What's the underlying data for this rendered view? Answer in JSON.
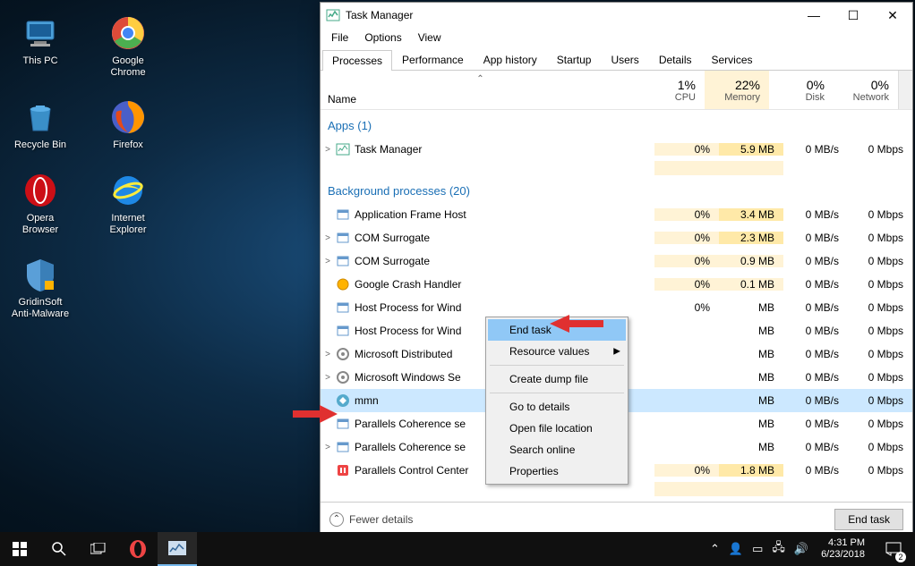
{
  "desktop": {
    "icons": [
      [
        {
          "name": "this-pc",
          "label": "This PC"
        },
        {
          "name": "chrome",
          "label": "Google Chrome"
        }
      ],
      [
        {
          "name": "recycle-bin",
          "label": "Recycle Bin"
        },
        {
          "name": "firefox",
          "label": "Firefox"
        }
      ],
      [
        {
          "name": "opera",
          "label": "Opera Browser"
        },
        {
          "name": "ie",
          "label": "Internet Explorer"
        }
      ],
      [
        {
          "name": "gridinsoft",
          "label": "GridinSoft Anti-Malware"
        }
      ]
    ]
  },
  "window": {
    "title": "Task Manager",
    "menu": [
      "File",
      "Options",
      "View"
    ],
    "tabs": [
      "Processes",
      "Performance",
      "App history",
      "Startup",
      "Users",
      "Details",
      "Services"
    ],
    "active_tab": 0,
    "columns": {
      "name": "Name",
      "cols": [
        {
          "pct": "1%",
          "lbl": "CPU",
          "hi": false
        },
        {
          "pct": "22%",
          "lbl": "Memory",
          "hi": true
        },
        {
          "pct": "0%",
          "lbl": "Disk",
          "hi": false
        },
        {
          "pct": "0%",
          "lbl": "Network",
          "hi": false
        }
      ]
    },
    "groups": [
      {
        "title": "Apps (1)",
        "rows": [
          {
            "expand": ">",
            "icon": "tm",
            "name": "Task Manager",
            "cpu": "0%",
            "mem": "5.9 MB",
            "disk": "0 MB/s",
            "net": "0 Mbps",
            "memhi": true
          }
        ]
      },
      {
        "title": "Background processes (20)",
        "rows": [
          {
            "expand": "",
            "icon": "app",
            "name": "Application Frame Host",
            "cpu": "0%",
            "mem": "3.4 MB",
            "disk": "0 MB/s",
            "net": "0 Mbps",
            "memhi": true
          },
          {
            "expand": ">",
            "icon": "app",
            "name": "COM Surrogate",
            "cpu": "0%",
            "mem": "2.3 MB",
            "disk": "0 MB/s",
            "net": "0 Mbps",
            "memhi": true
          },
          {
            "expand": ">",
            "icon": "app",
            "name": "COM Surrogate",
            "cpu": "0%",
            "mem": "0.9 MB",
            "disk": "0 MB/s",
            "net": "0 Mbps"
          },
          {
            "expand": "",
            "icon": "gch",
            "name": "Google Crash Handler",
            "cpu": "0%",
            "mem": "0.1 MB",
            "disk": "0 MB/s",
            "net": "0 Mbps"
          },
          {
            "expand": "",
            "icon": "app",
            "name": "Host Process for Wind",
            "cpu": "0%",
            "mem": "MB",
            "disk": "0 MB/s",
            "net": "0 Mbps",
            "cut": true
          },
          {
            "expand": "",
            "icon": "app",
            "name": "Host Process for Wind",
            "cpu": "",
            "mem": "MB",
            "disk": "0 MB/s",
            "net": "0 Mbps",
            "cut": true
          },
          {
            "expand": ">",
            "icon": "svc",
            "name": "Microsoft Distributed",
            "cpu": "",
            "mem": "MB",
            "disk": "0 MB/s",
            "net": "0 Mbps",
            "cut": true
          },
          {
            "expand": ">",
            "icon": "svc",
            "name": "Microsoft Windows Se",
            "cpu": "",
            "mem": "MB",
            "disk": "0 MB/s",
            "net": "0 Mbps",
            "cut": true
          },
          {
            "expand": "",
            "icon": "mmn",
            "name": "mmn",
            "cpu": "",
            "mem": "MB",
            "disk": "0 MB/s",
            "net": "0 Mbps",
            "selected": true,
            "cut": true
          },
          {
            "expand": "",
            "icon": "app",
            "name": "Parallels Coherence se",
            "cpu": "",
            "mem": "MB",
            "disk": "0 MB/s",
            "net": "0 Mbps",
            "cut": true
          },
          {
            "expand": ">",
            "icon": "app",
            "name": "Parallels Coherence se",
            "cpu": "",
            "mem": "MB",
            "disk": "0 MB/s",
            "net": "0 Mbps",
            "cut": true
          },
          {
            "expand": "",
            "icon": "pcc",
            "name": "Parallels Control Center",
            "cpu": "0%",
            "mem": "1.8 MB",
            "disk": "0 MB/s",
            "net": "0 Mbps",
            "memhi": true
          }
        ]
      }
    ],
    "context_menu": [
      {
        "label": "End task",
        "highlighted": true
      },
      {
        "label": "Resource values",
        "submenu": true
      },
      {
        "sep": true
      },
      {
        "label": "Create dump file"
      },
      {
        "sep": true
      },
      {
        "label": "Go to details"
      },
      {
        "label": "Open file location"
      },
      {
        "label": "Search online"
      },
      {
        "label": "Properties"
      }
    ],
    "footer": {
      "fewer": "Fewer details",
      "end_task": "End task"
    }
  },
  "taskbar": {
    "clock_time": "4:31 PM",
    "clock_date": "6/23/2018",
    "notif_count": "2"
  }
}
